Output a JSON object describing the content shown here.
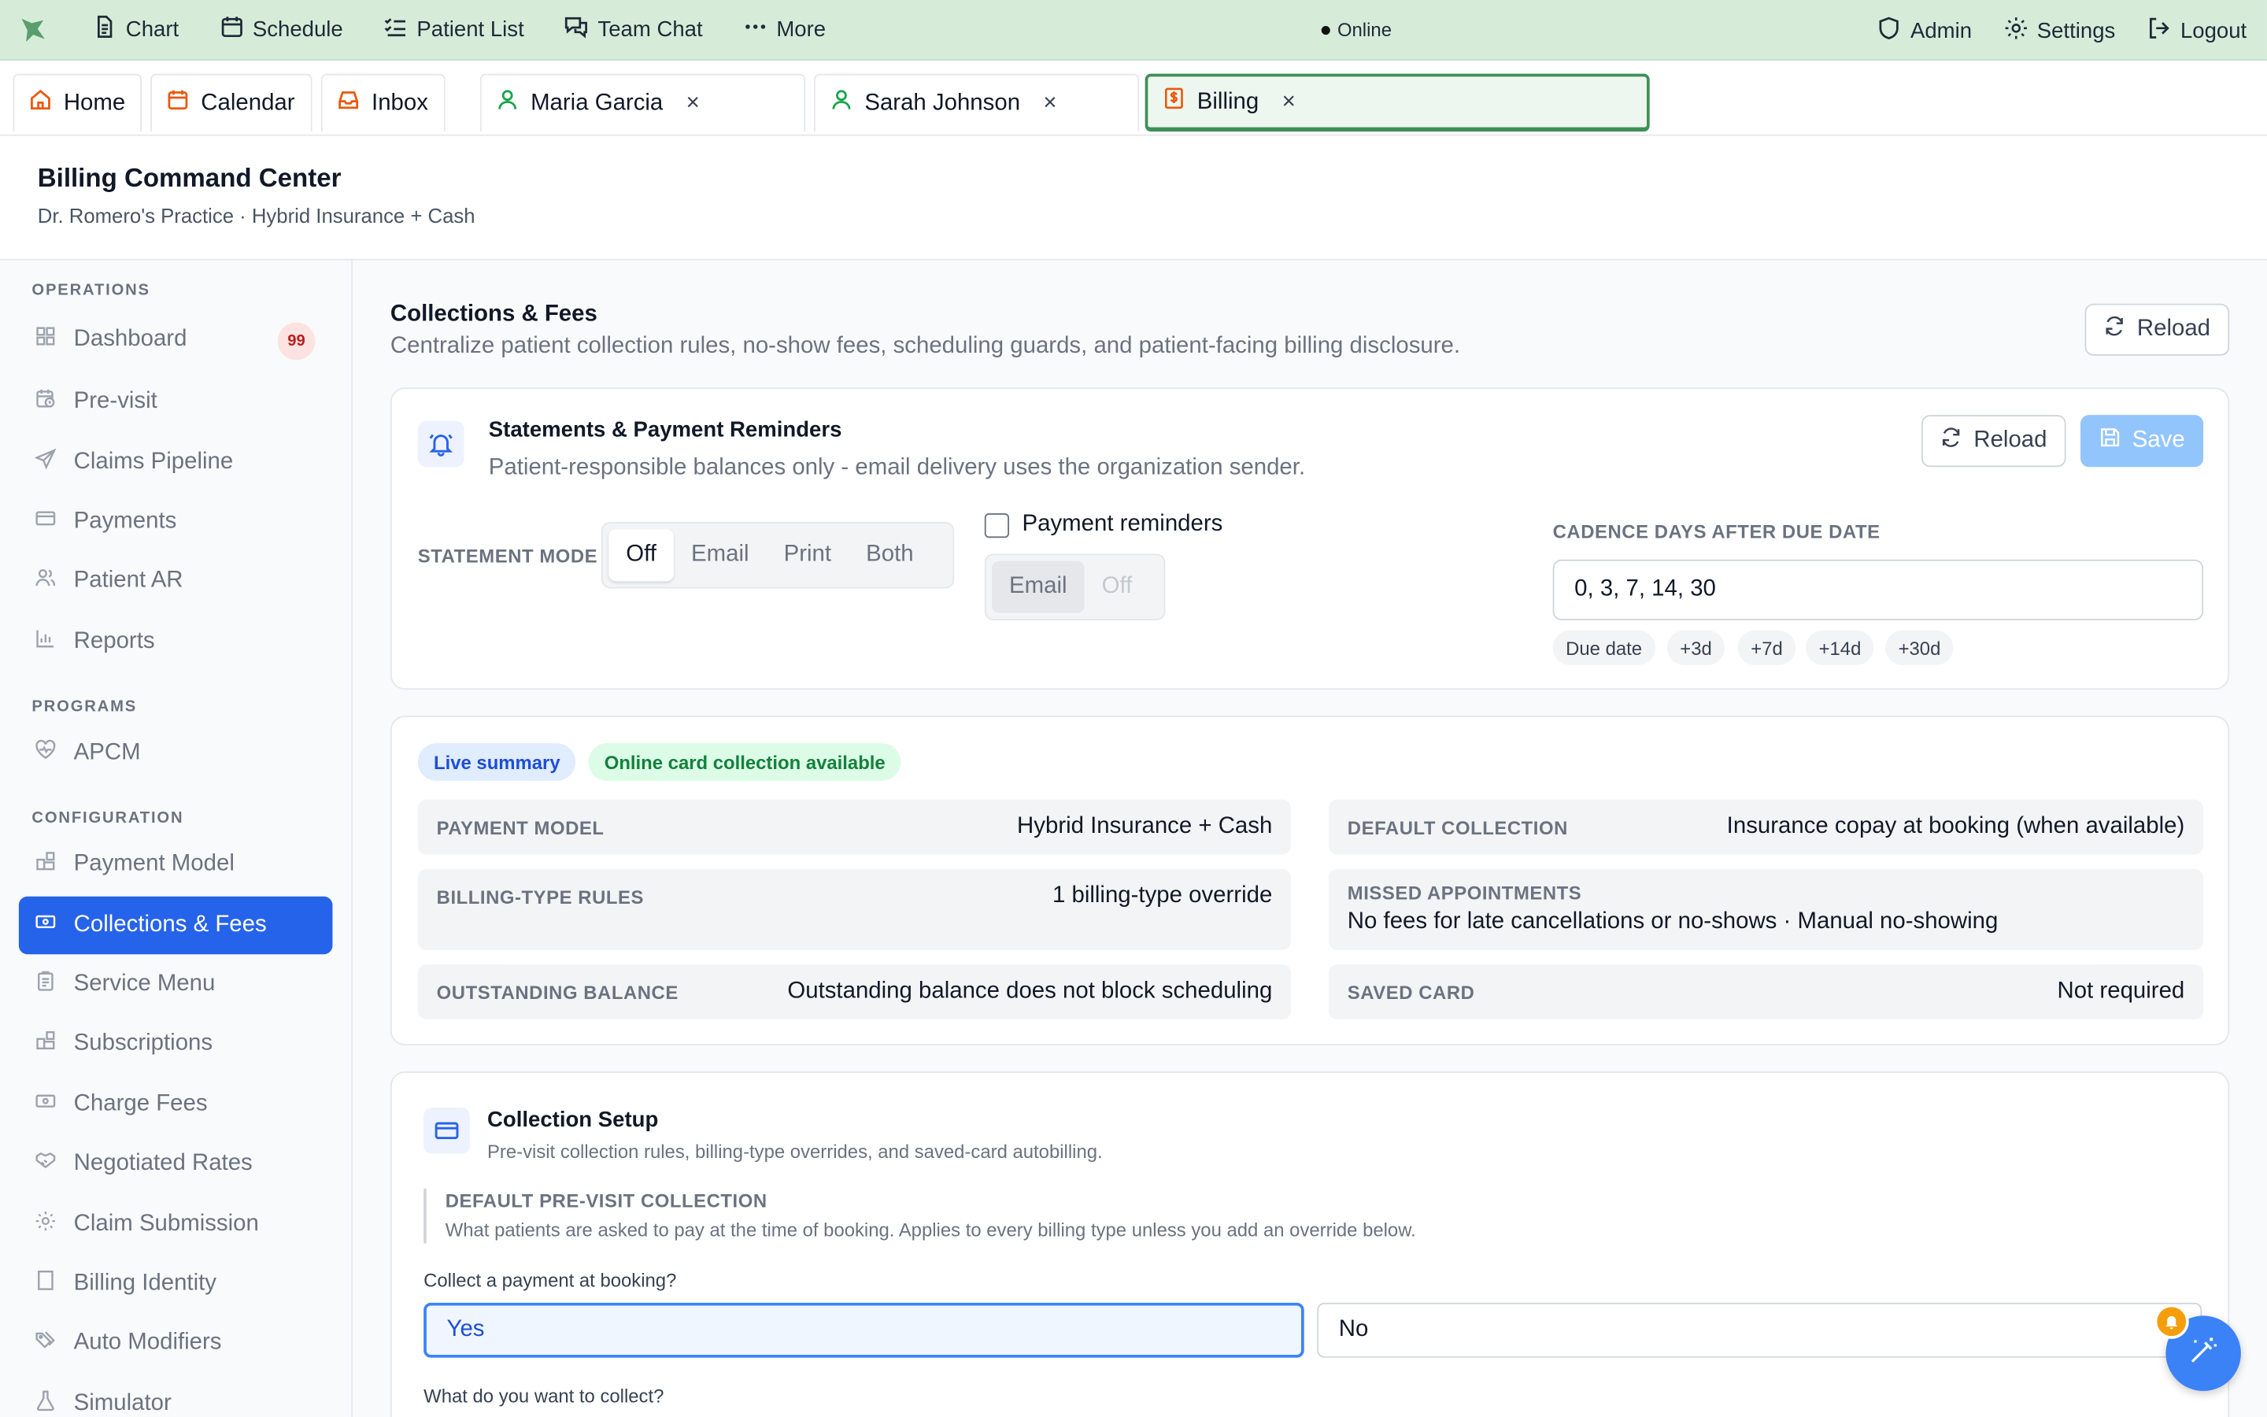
{
  "topbar": {
    "nav": [
      "Chart",
      "Schedule",
      "Patient List",
      "Team Chat",
      "More"
    ],
    "status": "Online",
    "right": [
      "Admin",
      "Settings",
      "Logout"
    ]
  },
  "tabs": {
    "fixed": [
      "Home",
      "Calendar",
      "Inbox"
    ],
    "patients": [
      "Maria Garcia",
      "Sarah Johnson"
    ],
    "active": "Billing",
    "close_glyph": "×"
  },
  "header": {
    "title": "Billing Command Center",
    "subtitle": "Dr. Romero's Practice · Hybrid Insurance + Cash"
  },
  "sidebar": {
    "sections": {
      "operations": "OPERATIONS",
      "programs": "PROGRAMS",
      "configuration": "CONFIGURATION"
    },
    "operations": [
      "Dashboard",
      "Pre-visit",
      "Claims Pipeline",
      "Payments",
      "Patient AR",
      "Reports"
    ],
    "dashboard_badge": "99",
    "programs": [
      "APCM"
    ],
    "configuration": [
      "Payment Model",
      "Collections & Fees",
      "Service Menu",
      "Subscriptions",
      "Charge Fees",
      "Negotiated Rates",
      "Claim Submission",
      "Billing Identity",
      "Auto Modifiers",
      "Simulator"
    ],
    "active_item": "Collections & Fees"
  },
  "main": {
    "title": "Collections & Fees",
    "subtitle": "Centralize patient collection rules, no-show fees, scheduling guards, and patient-facing billing disclosure.",
    "reload": "Reload"
  },
  "statements": {
    "title": "Statements & Payment Reminders",
    "subtitle": "Patient-responsible balances only - email delivery uses the organization sender.",
    "reload": "Reload",
    "save": "Save",
    "mode_label": "STATEMENT MODE",
    "mode_options": [
      "Off",
      "Email",
      "Print",
      "Both"
    ],
    "mode_selected": "Off",
    "reminders_label": "Payment reminders",
    "reminders_checked": false,
    "reminder_channels": [
      "Email",
      "Off"
    ],
    "cadence_label": "CADENCE DAYS AFTER DUE DATE",
    "cadence_value": "0, 3, 7, 14, 30",
    "cadence_chips": [
      "Due date",
      "+3d",
      "+7d",
      "+14d",
      "+30d"
    ]
  },
  "summary": {
    "pill_live": "Live summary",
    "pill_online": "Online card collection available",
    "rows": [
      {
        "key": "PAYMENT MODEL",
        "value": "Hybrid Insurance + Cash"
      },
      {
        "key": "DEFAULT COLLECTION",
        "value": "Insurance copay at booking (when available)"
      },
      {
        "key": "BILLING-TYPE RULES",
        "value": "1 billing-type override"
      },
      {
        "key": "MISSED APPOINTMENTS",
        "value": "No fees for late cancellations or no-shows · Manual no-showing"
      },
      {
        "key": "OUTSTANDING BALANCE",
        "value": "Outstanding balance does not block scheduling"
      },
      {
        "key": "SAVED CARD",
        "value": "Not required"
      }
    ]
  },
  "collection_setup": {
    "title": "Collection Setup",
    "subtitle": "Pre-visit collection rules, billing-type overrides, and saved-card autobilling.",
    "default_label": "DEFAULT PRE-VISIT COLLECTION",
    "default_desc": "What patients are asked to pay at the time of booking. Applies to every billing type unless you add an override below.",
    "question1": "Collect a payment at booking?",
    "yes": "Yes",
    "no": "No",
    "selected": "Yes",
    "question2": "What do you want to collect?"
  },
  "colors": {
    "topbar": "#d6ecd9",
    "accent": "#2563eb",
    "active_tab_border": "#3f8f57",
    "badge_bg": "#fde2e2"
  }
}
